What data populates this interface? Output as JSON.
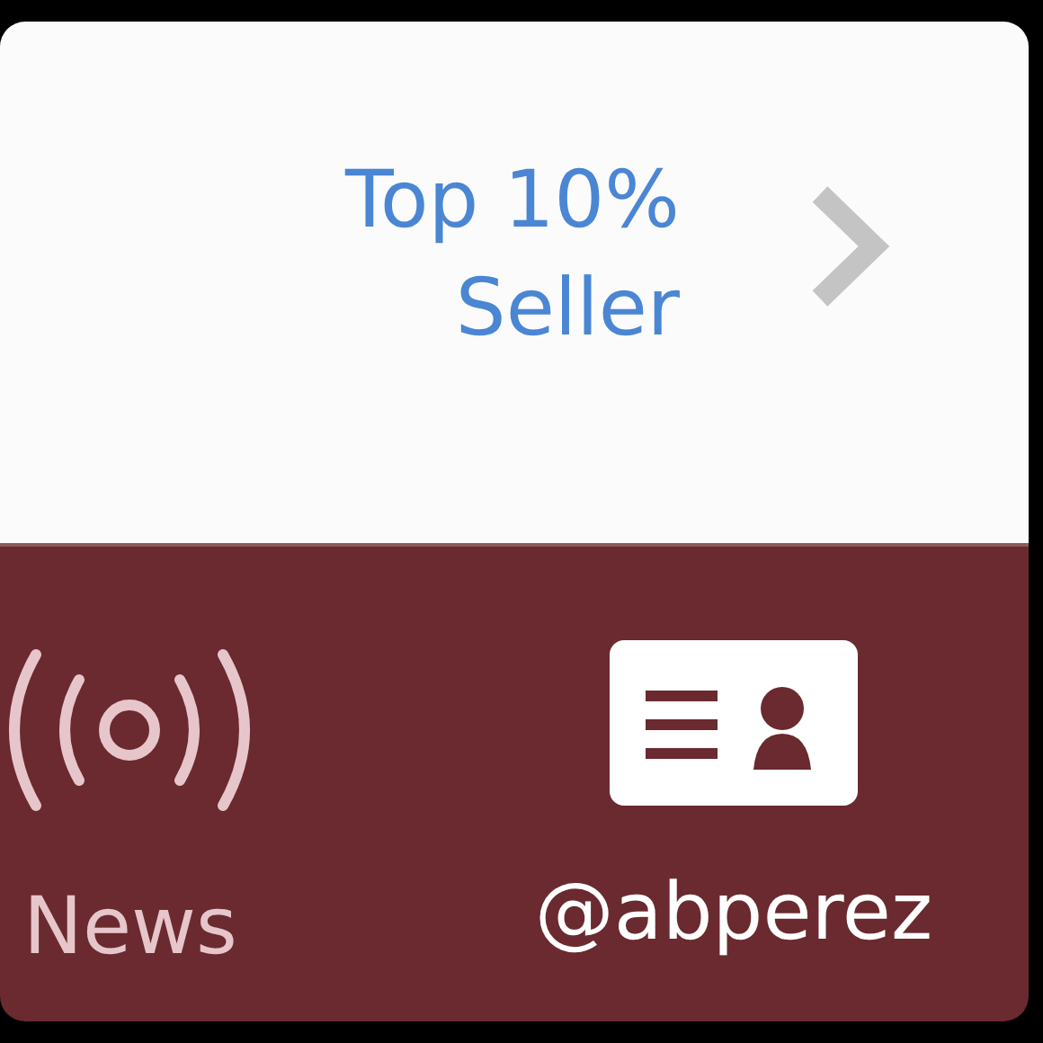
{
  "badge": {
    "line1": "Top 10%",
    "line2": "Seller"
  },
  "tabs": [
    {
      "label": "News",
      "kind": "news",
      "selected": false
    },
    {
      "label": "@abperez",
      "kind": "profile",
      "selected": true
    }
  ]
}
